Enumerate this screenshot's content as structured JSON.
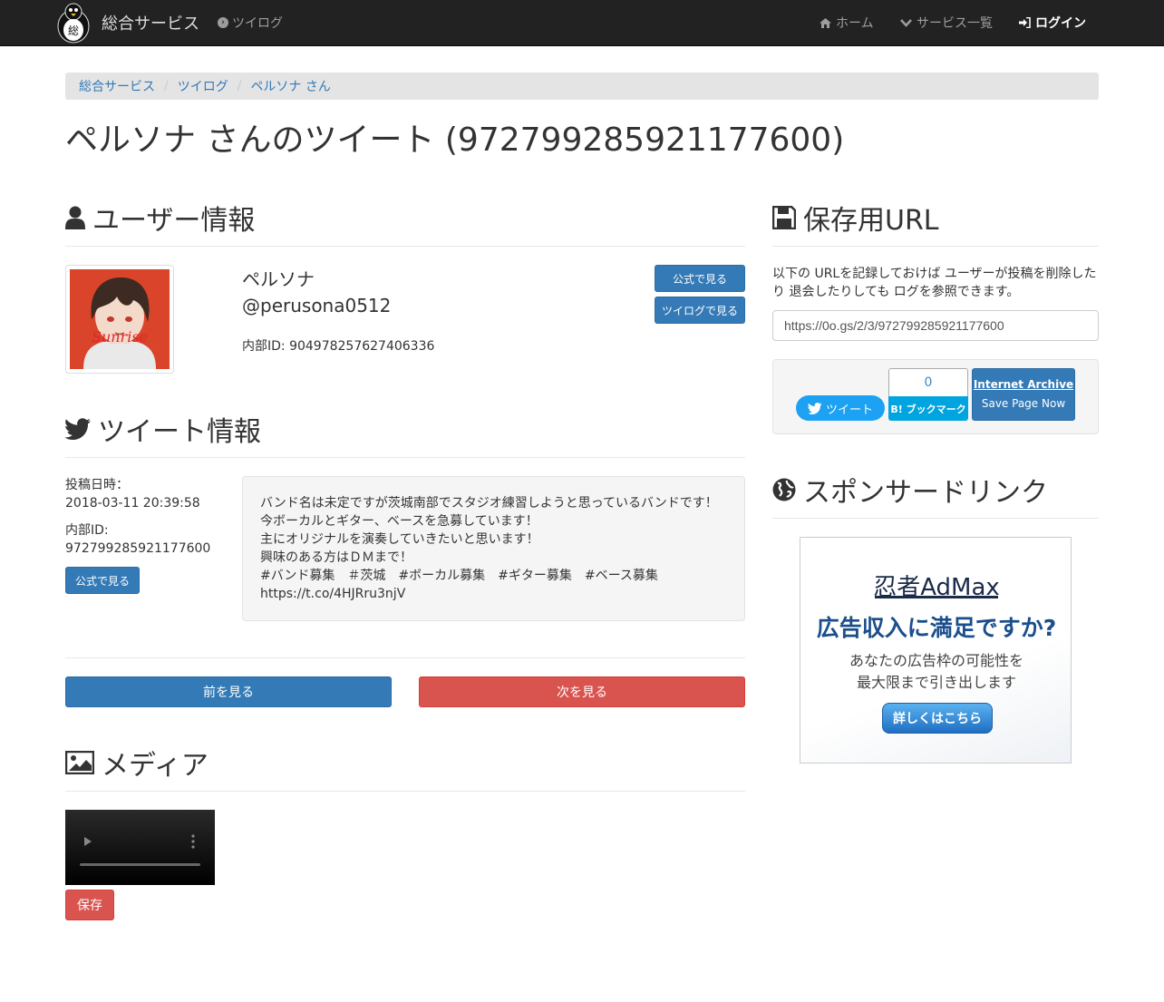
{
  "nav": {
    "brand": "総合サービス",
    "twilog": "ツイログ",
    "home": "ホーム",
    "services": "サービス一覧",
    "login": "ログイン"
  },
  "breadcrumb": [
    "総合サービス",
    "ツイログ",
    "ペルソナ さん"
  ],
  "page_title": "ペルソナ さんのツイート (972799285921177600)",
  "user_section": {
    "heading": "ユーザー情報",
    "display_name": "ペルソナ",
    "screen_name": "@perusona0512",
    "inner_id": "内部ID: 904978257627406336",
    "btn_official": "公式で見る",
    "btn_twilog": "ツイログで見る"
  },
  "tweet_section": {
    "heading": "ツイート情報",
    "posted_label": "投稿日時：",
    "posted_value": "2018-03-11 20:39:58",
    "id_label": "内部ID:",
    "id_value": "972799285921177600",
    "btn_official": "公式で見る",
    "lines": [
      "バンド名は未定ですが茨城南部でスタジオ練習しようと思っているバンドです！",
      "今ボーカルとギター、ベースを急募しています！",
      "主にオリジナルを演奏していきたいと思います！",
      "興味のある方はＤＭまで！",
      "#バンド募集　＃茨城　#ボーカル募集　#ギター募集　#ベース募集",
      "https://t.co/4HJRru3njV"
    ]
  },
  "pager": {
    "prev": "前を見る",
    "next": "次を見る"
  },
  "media_section": {
    "heading": "メディア",
    "save": "保存"
  },
  "save_url_section": {
    "heading": "保存用URL",
    "description": "以下の URLを記録しておけば ユーザーが投稿を削除したり 退会したりしても ログを参照できます。",
    "url": "https://0o.gs/2/3/972799285921177600",
    "tweet_btn": "ツイート",
    "hatena_count": "0",
    "hatena_btn": "B! ブックマーク",
    "ia_title": "Internet Archive",
    "ia_sub": "Save Page Now"
  },
  "sponsor_section": {
    "heading": "スポンサードリンク",
    "ad_brand": "忍者AdMax",
    "ad_headline": "広告収入に満足ですか?",
    "ad_sub1": "あなたの広告枠の可能性を",
    "ad_sub2": "最大限まで引き出します",
    "ad_btn": "詳しくはこちら"
  },
  "colors": {
    "primary": "#337ab7",
    "danger": "#d9534f",
    "navbar": "#222222"
  },
  "icons": [
    "user-icon",
    "twitter-icon",
    "save-icon",
    "globe-icon",
    "image-icon",
    "home-icon",
    "chevron-down-icon",
    "login-icon"
  ]
}
